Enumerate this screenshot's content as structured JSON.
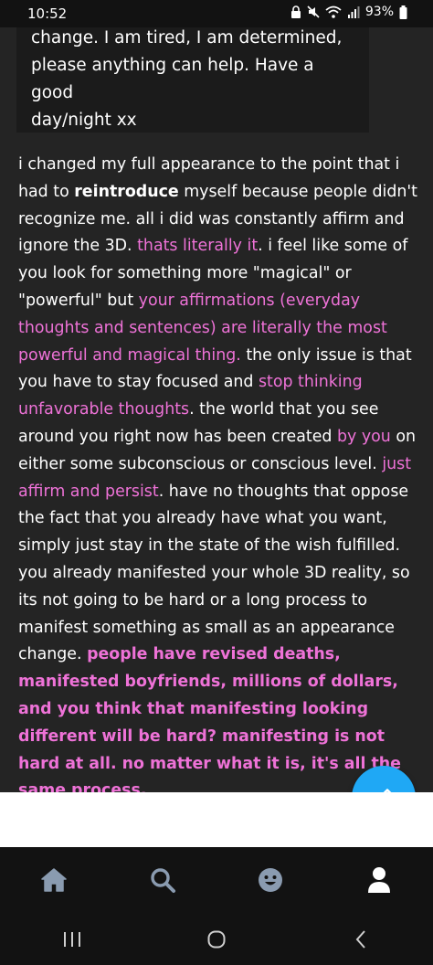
{
  "status_bar": {
    "time": "10:52",
    "battery": "93%",
    "icons": [
      "lock-icon",
      "mute-icon",
      "wifi-icon",
      "signal-icon",
      "battery-icon"
    ]
  },
  "quote": {
    "text": "change. I am tired, I am determined,\nplease anything can help. Have a good\nday/night xx"
  },
  "post": {
    "segments": [
      {
        "text": "i changed my full appearance to the point that i had to ",
        "style": "plain"
      },
      {
        "text": "reintroduce",
        "style": "bold"
      },
      {
        "text": " myself because people didn't recognize me. all i did was constantly affirm and ignore the 3D. ",
        "style": "plain"
      },
      {
        "text": "thats literally it",
        "style": "pink"
      },
      {
        "text": ". i feel like some of you look for something more \"magical\" or \"powerful\" but ",
        "style": "plain"
      },
      {
        "text": "your affirmations (everyday thoughts and sentences) are literally the most powerful and magical thing.",
        "style": "pink"
      },
      {
        "text": " the only issue is that you have to stay focused and ",
        "style": "plain"
      },
      {
        "text": "stop thinking unfavorable thoughts",
        "style": "pink"
      },
      {
        "text": ". the world that you see around you right now has been created ",
        "style": "plain"
      },
      {
        "text": "by you",
        "style": "pink"
      },
      {
        "text": " on either some subconscious or conscious level. ",
        "style": "plain"
      },
      {
        "text": "just affirm and persist",
        "style": "pink"
      },
      {
        "text": ". have no thoughts that oppose the fact that you already have what you want, simply just stay in the state of the wish fulfilled. you already manifested your whole 3D reality, so its not going to be hard or a long process to manifest something as small as an appearance change. ",
        "style": "plain"
      },
      {
        "text": "people have revised deaths, manifested boyfriends, millions of dollars, and you think that manifesting looking different will be hard? manifesting is not hard at all. no matter what it is, it's all the same process.",
        "style": "pink-bold"
      }
    ]
  },
  "fab": {
    "icon": "pencil-icon"
  },
  "tabs": [
    {
      "name": "home",
      "icon": "home-icon"
    },
    {
      "name": "search",
      "icon": "search-icon"
    },
    {
      "name": "activity",
      "icon": "smiley-icon"
    },
    {
      "name": "account",
      "icon": "person-icon"
    }
  ],
  "nav": [
    "recents-icon",
    "home-circle-icon",
    "back-icon"
  ],
  "colors": {
    "background": "#242424",
    "pink_highlight": "#ee72d7",
    "fab_blue": "#1fa8f5",
    "tab_icon_blue_gray": "#8a9bb0"
  }
}
